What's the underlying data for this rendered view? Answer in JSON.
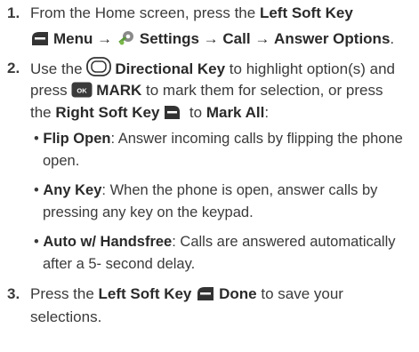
{
  "steps": [
    {
      "number": "1.",
      "lead": "From the Home screen, press the ",
      "lsk": "Left Soft Key",
      "menu": "Menu",
      "arrow1": "→",
      "settings": "Settings",
      "arrow2": "→",
      "call": "Call",
      "arrow3": "→",
      "answer": "Answer Options",
      "end": "."
    },
    {
      "number": "2.",
      "use": "Use the ",
      "dir": "Directional Key",
      "highlight": " to highlight option(s) and",
      "press": "press ",
      "ok_label": "OK",
      "mark": "MARK",
      "mark_rest": " to mark them for selection, or press",
      "the": "the ",
      "rsk": "Right Soft Key",
      "to": " to ",
      "markall": "Mark All",
      "colon": ":"
    },
    {
      "number": "3.",
      "press": "Press the ",
      "lsk": "Left Soft Key",
      "done": "Done",
      "rest": " to save your",
      "line2": "selections."
    }
  ],
  "options": [
    {
      "bullet": "•",
      "name": "Flip Open",
      "desc1": ": Answer incoming calls by flipping the phone",
      "desc2": "open."
    },
    {
      "bullet": "•",
      "name": "Any Key",
      "desc1": ": When the phone is open, answer calls by",
      "desc2": "pressing any key on the keypad."
    },
    {
      "bullet": "•",
      "name": "Auto w/ Handsfree",
      "desc1": ": Calls are answered automatically",
      "desc2": "after a 5- second delay."
    }
  ]
}
